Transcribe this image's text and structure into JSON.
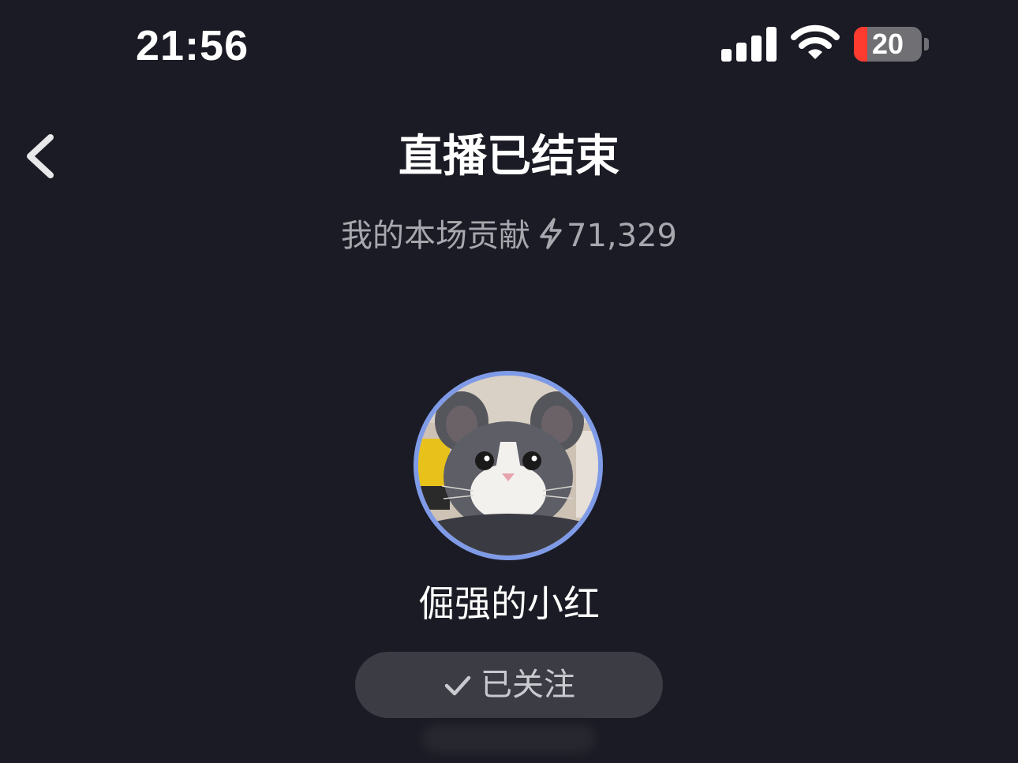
{
  "status_bar": {
    "time": "21:56",
    "battery_level": "20",
    "battery_fraction": 0.2,
    "battery_color": "#ff3b30",
    "signal_icon": "cellular-signal-icon",
    "wifi_icon": "wifi-icon"
  },
  "header": {
    "back_icon": "chevron-left-icon",
    "title": "直播已结束"
  },
  "contribution": {
    "label": "我的本场贡献",
    "icon": "lightning-icon",
    "value": "71,329"
  },
  "host": {
    "avatar_description": "cat-avatar",
    "ring_color": "#7f9be8",
    "name": "倔强的小红"
  },
  "follow_button": {
    "icon": "checkmark-icon",
    "label": "已关注"
  }
}
